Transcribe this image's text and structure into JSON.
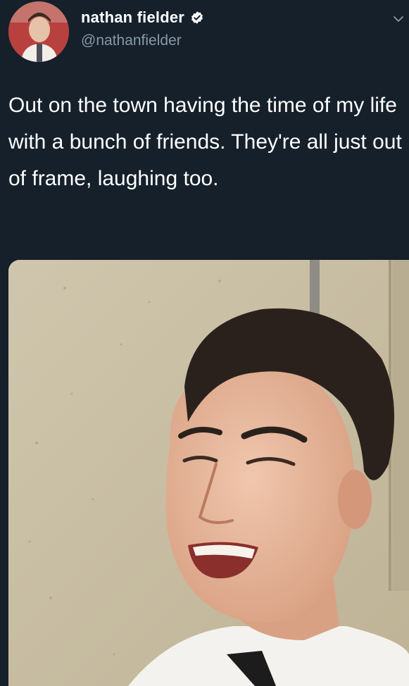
{
  "user": {
    "display_name": "nathan fielder",
    "handle": "@nathanfielder",
    "verified": true
  },
  "tweet": {
    "text": "Out on the town having the time of my life with a bunch of friends. They're all just out of frame, laughing too."
  },
  "icons": {
    "verified": "verified-badge-icon",
    "menu": "chevron-down-icon"
  },
  "colors": {
    "background": "#15202b",
    "text_primary": "#ffffff",
    "text_secondary": "#8899a6",
    "avatar_bg": "#b23a3a"
  }
}
